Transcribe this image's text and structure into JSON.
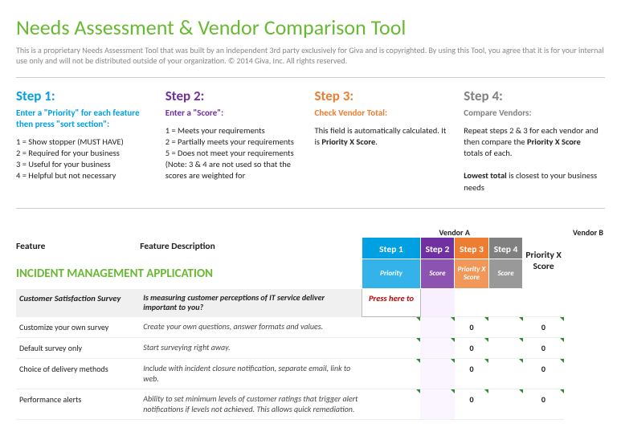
{
  "title": "Needs Assessment & Vendor Comparison Tool",
  "disclaimer": "This is a proprietary Needs Assessment Tool that was built by an independent 3rd party exclusively for Giva and is copyrighted. By using this Tool, you agree that it is for your internal use only and will not be distributed outside of your organization. © 2014 Giva, Inc. All rights reserved.",
  "steps": {
    "s1": {
      "title": "Step 1:",
      "sub": "Enter a \"Priority\" for each feature then press \"sort section\":",
      "body": "1 = Show stopper (MUST HAVE)\n2 = Required for your business\n3 = Useful for your business\n4 = Helpful but not necessary"
    },
    "s2": {
      "title": "Step 2:",
      "sub": "Enter a \"Score\":",
      "body": "1 = Meets your requirements\n2 = Partially meets your requirements\n5 = Does not meet your requirements\n(Note: 3 & 4 are not used so that the scores are weighted for"
    },
    "s3": {
      "title": "Step 3:",
      "sub": "Check Vendor Total:",
      "body_html": "This field is automatically calculated. It is <b>Priority X Score</b>."
    },
    "s4": {
      "title": "Step 4:",
      "sub": "Compare Vendors:",
      "body_html": "Repeat steps 2 & 3 for each vendor and then compare the <b>Priority X Score</b> totals of each.<br><br><b>Lowest total</b> is closest to your business needs"
    }
  },
  "vendors": {
    "a": "Vendor A",
    "b": "Vendor B"
  },
  "headers": {
    "feature": "Feature",
    "desc": "Feature Description",
    "step1": "Step 1",
    "step2": "Step 2",
    "step3": "Step 3",
    "step4": "Step 4",
    "px": "Priority X Score",
    "priority": "Priority",
    "score": "Score",
    "pxs": "Priority X Score"
  },
  "section": "INCIDENT MANAGEMENT APPLICATION",
  "group": {
    "name": "Customer Satisfaction Survey",
    "desc": "Is measuring customer perceptions of IT service deliver important to you?",
    "press": "Press here to"
  },
  "rows": [
    {
      "f": "Customize your own survey",
      "d": "Create your own questions, answer formats and values.",
      "v3": "0",
      "v5": "0"
    },
    {
      "f": "Default survey only",
      "d": "Start surveying right away.",
      "v3": "0",
      "v5": "0"
    },
    {
      "f": "Choice of delivery methods",
      "d": "Include with incident closure notification, separate email, link to web.",
      "v3": "0",
      "v5": "0"
    },
    {
      "f": "Performance alerts",
      "d": "Ability to set minimum levels of customer ratings that trigger alert notifications if levels not achieved. This allows quick remediation.",
      "v3": "0",
      "v5": "0"
    }
  ]
}
